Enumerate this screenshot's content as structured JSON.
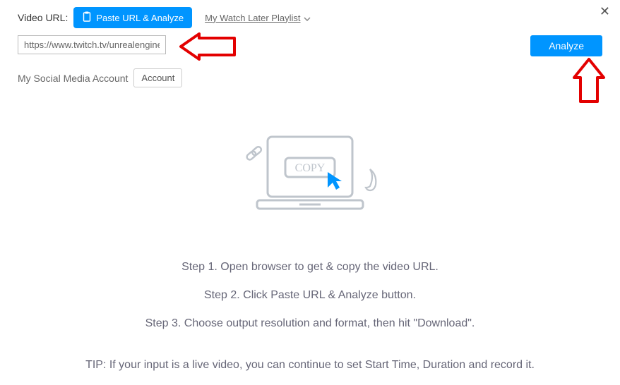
{
  "header": {
    "video_url_label": "Video URL:",
    "paste_button": "Paste URL & Analyze",
    "playlist_link": "My Watch Later Playlist"
  },
  "url_input_value": "https://www.twitch.tv/unrealengine",
  "analyze_button": "Analyze",
  "account": {
    "label": "My Social Media Account",
    "button": "Account"
  },
  "illustration": {
    "copy_label": "COPY"
  },
  "steps": {
    "s1": "Step 1. Open browser to get & copy the video URL.",
    "s2": "Step 2. Click Paste URL & Analyze button.",
    "s3": "Step 3. Choose output resolution and format, then hit \"Download\"."
  },
  "tip": "TIP: If your input is a live video, you can continue to set Start Time, Duration and record it."
}
